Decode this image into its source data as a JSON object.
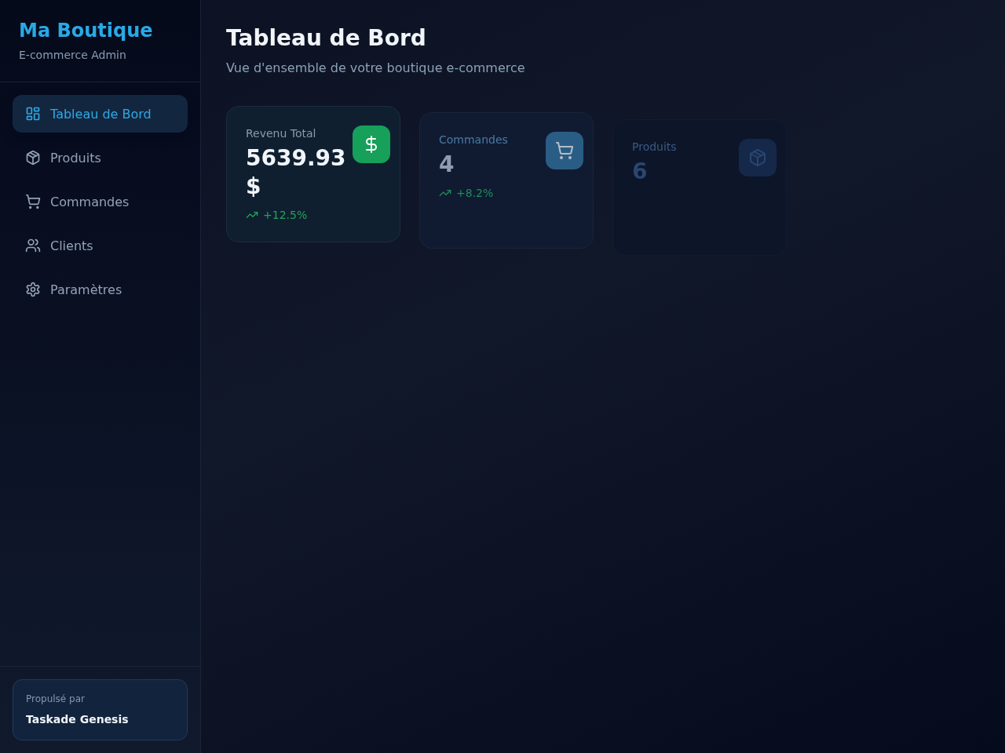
{
  "sidebar": {
    "brand": {
      "title": "Ma Boutique",
      "subtitle": "E-commerce Admin"
    },
    "items": [
      {
        "label": "Tableau de Bord",
        "selected": true
      },
      {
        "label": "Produits",
        "selected": false
      },
      {
        "label": "Commandes",
        "selected": false
      },
      {
        "label": "Clients",
        "selected": false
      },
      {
        "label": "Paramètres",
        "selected": false
      }
    ],
    "footer": {
      "caption": "Propulsé par",
      "name": "Taskade Genesis"
    }
  },
  "header": {
    "title": "Tableau de Bord",
    "subtitle": "Vue d'ensemble de votre boutique e-commerce"
  },
  "stats": [
    {
      "kind": "solid",
      "label": "Revenu Total",
      "value": "5639.93 $",
      "trend": "+12.5%",
      "color": "#16a05a"
    },
    {
      "kind": "fading",
      "label": "Commandes",
      "value": "4",
      "trend": "+8.2%",
      "color": "#2a5d85"
    },
    {
      "kind": "faint",
      "label": "Produits",
      "value": "6",
      "color": "#15284a"
    }
  ]
}
